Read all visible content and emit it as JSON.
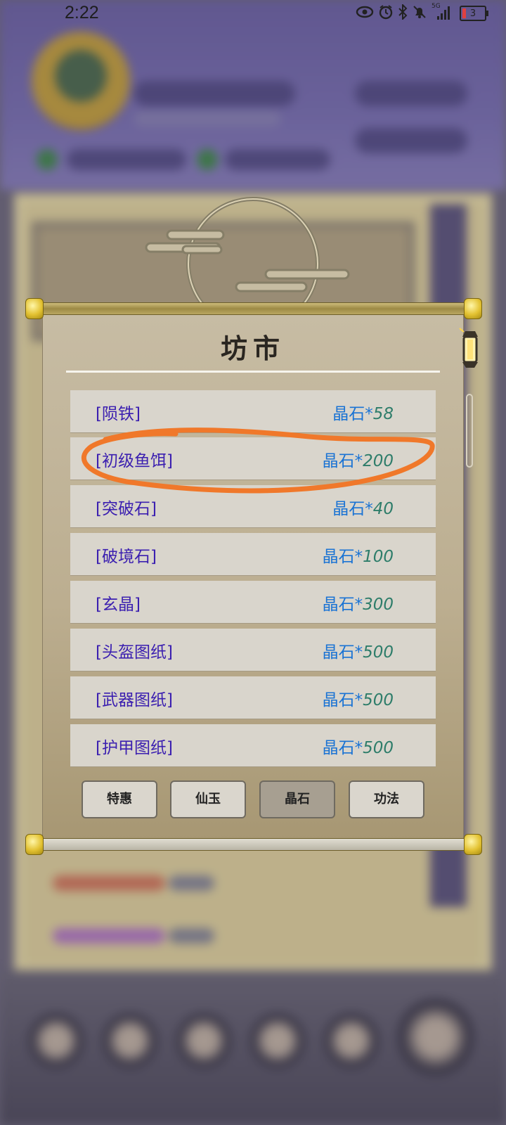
{
  "status_bar": {
    "time": "2:22",
    "network": "5G",
    "battery": "3",
    "icons": [
      "eye-icon",
      "alarm-icon",
      "bluetooth-icon",
      "mute-icon",
      "signal-icon",
      "battery-icon"
    ]
  },
  "market": {
    "title": "坊市",
    "items": [
      {
        "name": "[陨铁]",
        "currency": "晶石*",
        "price": "58"
      },
      {
        "name": "[初级鱼饵]",
        "currency": "晶石*",
        "price": "200"
      },
      {
        "name": "[突破石]",
        "currency": "晶石*",
        "price": "40"
      },
      {
        "name": "[破境石]",
        "currency": "晶石*",
        "price": "100"
      },
      {
        "name": "[玄晶]",
        "currency": "晶石*",
        "price": "300"
      },
      {
        "name": "[头盔图纸]",
        "currency": "晶石*",
        "price": "500"
      },
      {
        "name": "[武器图纸]",
        "currency": "晶石*",
        "price": "500"
      },
      {
        "name": "[护甲图纸]",
        "currency": "晶石*",
        "price": "500"
      }
    ],
    "tabs": [
      {
        "label": "特惠",
        "active": false
      },
      {
        "label": "仙玉",
        "active": false
      },
      {
        "label": "晶石",
        "active": true
      },
      {
        "label": "功法",
        "active": false
      }
    ]
  },
  "colors": {
    "item_name": "#3b1fb0",
    "currency": "#1a73d4",
    "price": "#2e7d6a",
    "annotation": "#f0782a"
  }
}
